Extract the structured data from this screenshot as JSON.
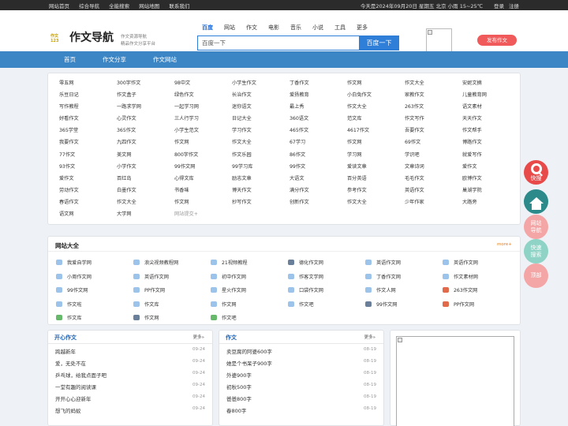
{
  "topbar": {
    "links": [
      "网站首页",
      "综合导航",
      "全能搜索",
      "网站地图",
      "联系我们"
    ],
    "date": "今天是2024年09月20日 星期五 北京 小雨 15~25℃",
    "login": "登录",
    "register": "注册"
  },
  "header": {
    "logo_mark": "作文123",
    "logo_text": "作文导航",
    "slogan1": "作文资源导航",
    "slogan2": "精品作文分享平台",
    "search_tabs": [
      "百度",
      "网站",
      "作文",
      "电影",
      "音乐",
      "小说",
      "工具",
      "更多"
    ],
    "search_placeholder": "百度一下",
    "search_button": "百度一下",
    "publish": "发布作文"
  },
  "nav": [
    "首页",
    "作文分享",
    "作文网站"
  ],
  "links": [
    "零五网",
    "300字作文",
    "98中文",
    "小学生作文",
    "丁香作文",
    "作文网",
    "作文大全",
    "安妮文摘",
    "乐豆日记",
    "作文盒子",
    "绿色作文",
    "长治作文",
    "爱扬教育",
    "小白兔作文",
    "家教作文",
    "儿童教育网",
    "写作教程",
    "一路求学网",
    "一起学习网",
    "迷你语文",
    "最上秀",
    "作文大全",
    "263作文",
    "语文素材",
    "好看作文",
    "心灵作文",
    "三人行学习",
    "日记大全",
    "360语文",
    "范文库",
    "作文写作",
    "天天作文",
    "365学堂",
    "365作文",
    "小学生范文",
    "学习作文",
    "465作文",
    "4617作文",
    "吾要作文",
    "作文帮手",
    "我要作文",
    "九四作文",
    "作文网",
    "作文大全",
    "67学习",
    "作文网",
    "69作文",
    "博路作文",
    "77作文",
    "美文网",
    "800字作文",
    "作文乐园",
    "86作文",
    "学习网",
    "学识吧",
    "就爱写作",
    "93作文",
    "小学作文",
    "99作文网",
    "99学习库",
    "99作文",
    "爱读文章",
    "文章诗词",
    "爱作文",
    "爱作文",
    "百红岛",
    "心得文库",
    "励志文章",
    "大语文",
    "百分英语",
    "毛毛作文",
    "欧博作文",
    "劳动作文",
    "白墨作文",
    "书香味",
    "博天作文",
    "满分作文",
    "参考作文",
    "英语作文",
    "巢湖学院",
    "春语作文",
    "作文大全",
    "作文网",
    "抄写作文",
    "创新作文",
    "作文大全",
    "少年作家",
    "大路旁",
    "语文网",
    "大学网",
    "网站提交+"
  ],
  "sites": {
    "title": "网站大全",
    "more": "more+",
    "items": [
      "我爱自学网",
      "浪尖视频教程网",
      "21视频教程",
      "德化作文网",
      "英语作文网",
      "英语作文网",
      "小周作文网",
      "英语作文网",
      "初中作文网",
      "作客文学网",
      "丁香作文网",
      "作文素材网",
      "99作文网",
      "PP作文网",
      "星火作文网",
      "口袋作文网",
      "作文人网",
      "263作文网",
      "作文啦",
      "作文库",
      "作文网",
      "作文吧",
      "99作文网",
      "PP作文网",
      "作文库",
      "作文网",
      "作文吧"
    ]
  },
  "panes": [
    {
      "title": "开心作文",
      "more": "更多»",
      "rows": [
        [
          "跨越新年",
          "09-24"
        ],
        [
          "爱，无处不在",
          "09-24"
        ],
        [
          "乒乓球，给我点面子吧",
          "09-24"
        ],
        [
          "一堂有趣的阅读课",
          "09-24"
        ],
        [
          "开开心心迎新年",
          "09-24"
        ],
        [
          "想飞的蚂蚁",
          "09-24"
        ]
      ]
    },
    {
      "title": "作文",
      "more": "更多»",
      "rows": [
        [
          "卖豆腐的阿婆600字",
          "08-19"
        ],
        [
          "她是个书呆子900字",
          "08-19"
        ],
        [
          "外婆900字",
          "08-19"
        ],
        [
          "初秋500字",
          "08-19"
        ],
        [
          "爸爸800字",
          "08-19"
        ],
        [
          "春800字",
          "08-19"
        ]
      ]
    }
  ],
  "side": {
    "search": "快搜",
    "nav1": "网站",
    "nav2": "导航",
    "fast1": "快速",
    "fast2": "搜索",
    "hot": "顶部"
  },
  "colors": {
    "nav": "#3c86c6",
    "accent": "#2f7fd8",
    "publish": "#f05a5a"
  }
}
